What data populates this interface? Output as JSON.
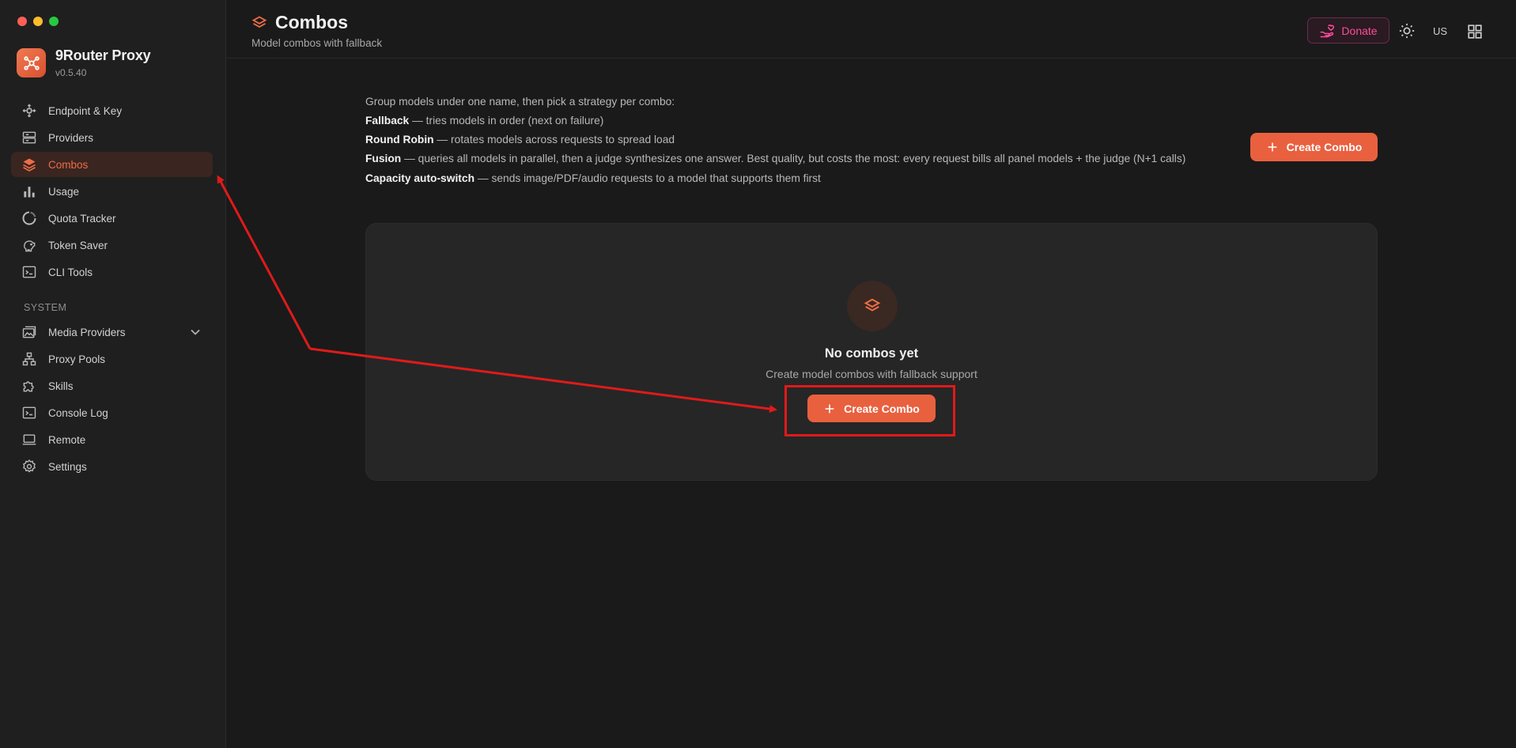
{
  "app": {
    "name": "9Router Proxy",
    "version": "v0.5.40"
  },
  "sidebar": {
    "items": [
      {
        "label": "Endpoint & Key",
        "icon": "endpoint-icon"
      },
      {
        "label": "Providers",
        "icon": "server-icon"
      },
      {
        "label": "Combos",
        "icon": "layers-icon",
        "active": true
      },
      {
        "label": "Usage",
        "icon": "bar-chart-icon"
      },
      {
        "label": "Quota Tracker",
        "icon": "ring-icon"
      },
      {
        "label": "Token Saver",
        "icon": "piggy-bank-icon"
      },
      {
        "label": "CLI Tools",
        "icon": "terminal-icon"
      }
    ],
    "system_section": "SYSTEM",
    "system_items": [
      {
        "label": "Media Providers",
        "icon": "media-icon",
        "expandable": true
      },
      {
        "label": "Proxy Pools",
        "icon": "network-icon"
      },
      {
        "label": "Skills",
        "icon": "puzzle-icon"
      },
      {
        "label": "Console Log",
        "icon": "console-icon"
      },
      {
        "label": "Remote",
        "icon": "laptop-icon"
      },
      {
        "label": "Settings",
        "icon": "gear-icon"
      }
    ]
  },
  "header": {
    "title": "Combos",
    "subtitle": "Model combos with fallback",
    "donate_label": "Donate",
    "lang": "US"
  },
  "intro": {
    "lead": "Group models under one name, then pick a strategy per combo:",
    "strategies": [
      {
        "name": "Fallback",
        "desc": " — tries models in order (next on failure)"
      },
      {
        "name": "Round Robin",
        "desc": " — rotates models across requests to spread load"
      },
      {
        "name": "Fusion",
        "desc": " — queries all models in parallel, then a judge synthesizes one answer. Best quality, but costs the most: every request bills all panel models + the judge (N+1 calls)"
      },
      {
        "name": "Capacity auto-switch",
        "desc": " — sends image/PDF/audio requests to a model that supports them first"
      }
    ]
  },
  "create_label": "Create Combo",
  "empty": {
    "title": "No combos yet",
    "subtitle": "Create model combos with fallback support",
    "button_label": "Create Combo"
  },
  "colors": {
    "accent": "#e9603f",
    "annotation": "#e01a1a",
    "donate": "#ff4d9a"
  }
}
